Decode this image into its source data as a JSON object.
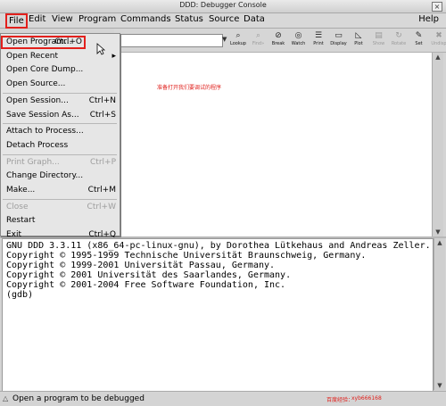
{
  "window": {
    "title": "DDD: Debugger Console",
    "close_glyph": "×"
  },
  "menubar": [
    "File",
    "Edit",
    "View",
    "Program",
    "Commands",
    "Status",
    "Source",
    "Data"
  ],
  "help_label": "Help",
  "toolbar": {
    "arg_dropdown_glyph": "▼",
    "buttons": [
      {
        "label": "Lookup",
        "icon": "lookup-icon",
        "glyph": "⌕",
        "enabled": true
      },
      {
        "label": "Find»",
        "icon": "find-icon",
        "glyph": "⌕",
        "enabled": false
      },
      {
        "label": "Break",
        "icon": "breakpoint-icon",
        "glyph": "⊘",
        "enabled": true
      },
      {
        "label": "Watch",
        "icon": "watch-icon",
        "glyph": "◎",
        "enabled": true
      },
      {
        "label": "Print",
        "icon": "print-icon",
        "glyph": "☰",
        "enabled": true
      },
      {
        "label": "Display",
        "icon": "display-icon",
        "glyph": "▭",
        "enabled": true
      },
      {
        "label": "Plot",
        "icon": "plot-icon",
        "glyph": "◺",
        "enabled": true
      },
      {
        "label": "Show",
        "icon": "show-icon",
        "glyph": "▤",
        "enabled": false
      },
      {
        "label": "Rotate",
        "icon": "rotate-icon",
        "glyph": "↻",
        "enabled": false
      },
      {
        "label": "Set",
        "icon": "set-icon",
        "glyph": "✎",
        "enabled": true
      },
      {
        "label": "Undisp",
        "icon": "undisplay-icon",
        "glyph": "✖",
        "enabled": false
      }
    ]
  },
  "annotation": "准备打开我们要调试的程序",
  "file_menu": [
    {
      "label": "Open Program...",
      "accel": "Ctrl+O",
      "enabled": true,
      "highlight": true
    },
    {
      "label": "Open Recent",
      "accel": "▸",
      "enabled": true
    },
    {
      "label": "Open Core Dump...",
      "accel": "",
      "enabled": true
    },
    {
      "label": "Open Source...",
      "accel": "",
      "enabled": true
    },
    {
      "sep": true
    },
    {
      "label": "Open Session...",
      "accel": "Ctrl+N",
      "enabled": true
    },
    {
      "label": "Save Session As...",
      "accel": "Ctrl+S",
      "enabled": true
    },
    {
      "sep": true
    },
    {
      "label": "Attach to Process...",
      "accel": "",
      "enabled": true
    },
    {
      "label": "Detach Process",
      "accel": "",
      "enabled": true
    },
    {
      "sep": true
    },
    {
      "label": "Print Graph...",
      "accel": "Ctrl+P",
      "enabled": false
    },
    {
      "label": "Change Directory...",
      "accel": "",
      "enabled": true
    },
    {
      "label": "Make...",
      "accel": "Ctrl+M",
      "enabled": true
    },
    {
      "sep": true
    },
    {
      "label": "Close",
      "accel": "Ctrl+W",
      "enabled": false
    },
    {
      "label": "Restart",
      "accel": "",
      "enabled": true
    },
    {
      "label": "Exit",
      "accel": "Ctrl+Q",
      "enabled": true
    }
  ],
  "console_lines": [
    "GNU DDD 3.3.11 (x86_64-pc-linux-gnu), by Dorothea Lütkehaus and Andreas Zeller.",
    "Copyright © 1995-1999 Technische Universität Braunschweig, Germany.",
    "Copyright © 1999-2001 Universität Passau, Germany.",
    "Copyright © 2001 Universität des Saarlandes, Germany.",
    "Copyright © 2001-2004 Free Software Foundation, Inc.",
    "(gdb)"
  ],
  "status_text": "Open a program to be debugged",
  "status_glyph": "△",
  "scroll_glyphs": {
    "up": "▲",
    "down": "▼"
  },
  "watermark": {
    "brand": "百度经验：",
    "user": "xyb666168"
  }
}
